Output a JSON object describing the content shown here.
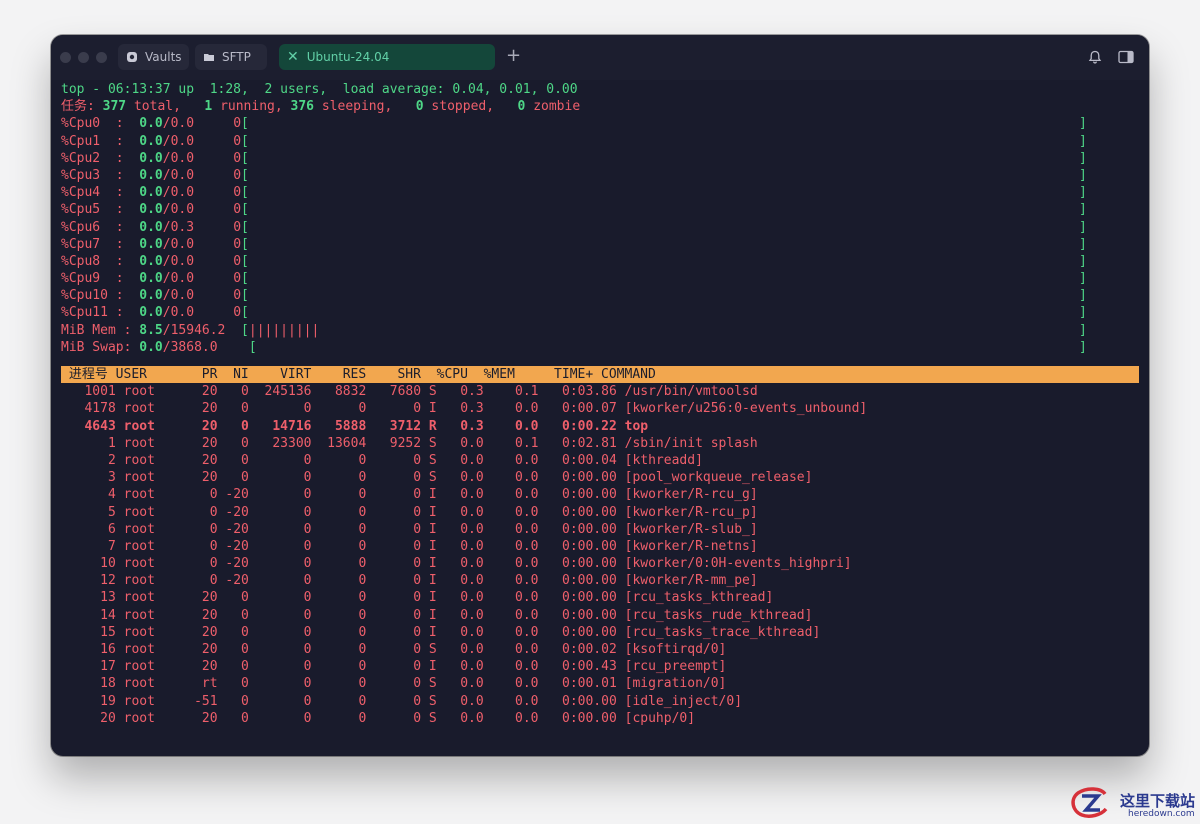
{
  "tabs": [
    {
      "label": "Vaults",
      "icon": "vaults-icon"
    },
    {
      "label": "SFTP",
      "icon": "folder-icon"
    },
    {
      "label": "Ubuntu-24.04",
      "icon": "close-icon",
      "active": true
    }
  ],
  "colors": {
    "background": "#191b2c",
    "green": "#4ed787",
    "red": "#ef5f6b",
    "header_bg": "#f2a74f",
    "active_tab": "#14473a"
  },
  "summary": {
    "top_line": "top - 06:13:37 up  1:28,  2 users,  load average: 0.04, 0.01, 0.00",
    "tasks_label": "任务:",
    "tasks_total": "377",
    "total_word": " total,",
    "running": "1",
    "running_word": " running,",
    "sleeping": "376",
    "sleeping_word": " sleeping,",
    "stopped": "0",
    "stopped_word": " stopped,",
    "zombie": "0",
    "zombie_word": " zombie"
  },
  "cpus": [
    {
      "label": "%Cpu0  :",
      "value": "0.0",
      "rest": "/0.0",
      "zero": "0"
    },
    {
      "label": "%Cpu1  :",
      "value": "0.0",
      "rest": "/0.0",
      "zero": "0"
    },
    {
      "label": "%Cpu2  :",
      "value": "0.0",
      "rest": "/0.0",
      "zero": "0"
    },
    {
      "label": "%Cpu3  :",
      "value": "0.0",
      "rest": "/0.0",
      "zero": "0"
    },
    {
      "label": "%Cpu4  :",
      "value": "0.0",
      "rest": "/0.0",
      "zero": "0"
    },
    {
      "label": "%Cpu5  :",
      "value": "0.0",
      "rest": "/0.0",
      "zero": "0"
    },
    {
      "label": "%Cpu6  :",
      "value": "0.0",
      "rest": "/0.3",
      "zero": "0"
    },
    {
      "label": "%Cpu7  :",
      "value": "0.0",
      "rest": "/0.0",
      "zero": "0"
    },
    {
      "label": "%Cpu8  :",
      "value": "0.0",
      "rest": "/0.0",
      "zero": "0"
    },
    {
      "label": "%Cpu9  :",
      "value": "0.0",
      "rest": "/0.0",
      "zero": "0"
    },
    {
      "label": "%Cpu10 :",
      "value": "0.0",
      "rest": "/0.0",
      "zero": "0"
    },
    {
      "label": "%Cpu11 :",
      "value": "0.0",
      "rest": "/0.0",
      "zero": "0"
    }
  ],
  "memory": [
    {
      "label": "MiB Mem :",
      "value": "8.5",
      "rest": "/15946.2",
      "bar": "|||||||||"
    },
    {
      "label": "MiB Swap:",
      "value": "0.0",
      "rest": "/3868.0",
      "bar": ""
    }
  ],
  "columns": [
    "进程号",
    "USER",
    "PR",
    "NI",
    "VIRT",
    "RES",
    "SHR",
    "",
    "%CPU",
    "%MEM",
    "TIME+",
    "COMMAND"
  ],
  "processes": [
    {
      "pid": "1001",
      "user": "root",
      "pr": "20",
      "ni": "0",
      "virt": "245136",
      "res": "8832",
      "shr": "7680",
      "s": "S",
      "cpu": "0.3",
      "mem": "0.1",
      "time": "0:03.86",
      "cmd": "/usr/bin/vmtoolsd"
    },
    {
      "pid": "4178",
      "user": "root",
      "pr": "20",
      "ni": "0",
      "virt": "0",
      "res": "0",
      "shr": "0",
      "s": "I",
      "cpu": "0.3",
      "mem": "0.0",
      "time": "0:00.07",
      "cmd": "[kworker/u256:0-events_unbound]"
    },
    {
      "pid": "4643",
      "user": "root",
      "pr": "20",
      "ni": "0",
      "virt": "14716",
      "res": "5888",
      "shr": "3712",
      "s": "R",
      "cpu": "0.3",
      "mem": "0.0",
      "time": "0:00.22",
      "cmd": "top",
      "bold": true
    },
    {
      "pid": "1",
      "user": "root",
      "pr": "20",
      "ni": "0",
      "virt": "23300",
      "res": "13604",
      "shr": "9252",
      "s": "S",
      "cpu": "0.0",
      "mem": "0.1",
      "time": "0:02.81",
      "cmd": "/sbin/init splash"
    },
    {
      "pid": "2",
      "user": "root",
      "pr": "20",
      "ni": "0",
      "virt": "0",
      "res": "0",
      "shr": "0",
      "s": "S",
      "cpu": "0.0",
      "mem": "0.0",
      "time": "0:00.04",
      "cmd": "[kthreadd]"
    },
    {
      "pid": "3",
      "user": "root",
      "pr": "20",
      "ni": "0",
      "virt": "0",
      "res": "0",
      "shr": "0",
      "s": "S",
      "cpu": "0.0",
      "mem": "0.0",
      "time": "0:00.00",
      "cmd": "[pool_workqueue_release]"
    },
    {
      "pid": "4",
      "user": "root",
      "pr": "0",
      "ni": "-20",
      "virt": "0",
      "res": "0",
      "shr": "0",
      "s": "I",
      "cpu": "0.0",
      "mem": "0.0",
      "time": "0:00.00",
      "cmd": "[kworker/R-rcu_g]"
    },
    {
      "pid": "5",
      "user": "root",
      "pr": "0",
      "ni": "-20",
      "virt": "0",
      "res": "0",
      "shr": "0",
      "s": "I",
      "cpu": "0.0",
      "mem": "0.0",
      "time": "0:00.00",
      "cmd": "[kworker/R-rcu_p]"
    },
    {
      "pid": "6",
      "user": "root",
      "pr": "0",
      "ni": "-20",
      "virt": "0",
      "res": "0",
      "shr": "0",
      "s": "I",
      "cpu": "0.0",
      "mem": "0.0",
      "time": "0:00.00",
      "cmd": "[kworker/R-slub_]"
    },
    {
      "pid": "7",
      "user": "root",
      "pr": "0",
      "ni": "-20",
      "virt": "0",
      "res": "0",
      "shr": "0",
      "s": "I",
      "cpu": "0.0",
      "mem": "0.0",
      "time": "0:00.00",
      "cmd": "[kworker/R-netns]"
    },
    {
      "pid": "10",
      "user": "root",
      "pr": "0",
      "ni": "-20",
      "virt": "0",
      "res": "0",
      "shr": "0",
      "s": "I",
      "cpu": "0.0",
      "mem": "0.0",
      "time": "0:00.00",
      "cmd": "[kworker/0:0H-events_highpri]"
    },
    {
      "pid": "12",
      "user": "root",
      "pr": "0",
      "ni": "-20",
      "virt": "0",
      "res": "0",
      "shr": "0",
      "s": "I",
      "cpu": "0.0",
      "mem": "0.0",
      "time": "0:00.00",
      "cmd": "[kworker/R-mm_pe]"
    },
    {
      "pid": "13",
      "user": "root",
      "pr": "20",
      "ni": "0",
      "virt": "0",
      "res": "0",
      "shr": "0",
      "s": "I",
      "cpu": "0.0",
      "mem": "0.0",
      "time": "0:00.00",
      "cmd": "[rcu_tasks_kthread]"
    },
    {
      "pid": "14",
      "user": "root",
      "pr": "20",
      "ni": "0",
      "virt": "0",
      "res": "0",
      "shr": "0",
      "s": "I",
      "cpu": "0.0",
      "mem": "0.0",
      "time": "0:00.00",
      "cmd": "[rcu_tasks_rude_kthread]"
    },
    {
      "pid": "15",
      "user": "root",
      "pr": "20",
      "ni": "0",
      "virt": "0",
      "res": "0",
      "shr": "0",
      "s": "I",
      "cpu": "0.0",
      "mem": "0.0",
      "time": "0:00.00",
      "cmd": "[rcu_tasks_trace_kthread]"
    },
    {
      "pid": "16",
      "user": "root",
      "pr": "20",
      "ni": "0",
      "virt": "0",
      "res": "0",
      "shr": "0",
      "s": "S",
      "cpu": "0.0",
      "mem": "0.0",
      "time": "0:00.02",
      "cmd": "[ksoftirqd/0]"
    },
    {
      "pid": "17",
      "user": "root",
      "pr": "20",
      "ni": "0",
      "virt": "0",
      "res": "0",
      "shr": "0",
      "s": "I",
      "cpu": "0.0",
      "mem": "0.0",
      "time": "0:00.43",
      "cmd": "[rcu_preempt]"
    },
    {
      "pid": "18",
      "user": "root",
      "pr": "rt",
      "ni": "0",
      "virt": "0",
      "res": "0",
      "shr": "0",
      "s": "S",
      "cpu": "0.0",
      "mem": "0.0",
      "time": "0:00.01",
      "cmd": "[migration/0]"
    },
    {
      "pid": "19",
      "user": "root",
      "pr": "-51",
      "ni": "0",
      "virt": "0",
      "res": "0",
      "shr": "0",
      "s": "S",
      "cpu": "0.0",
      "mem": "0.0",
      "time": "0:00.00",
      "cmd": "[idle_inject/0]"
    },
    {
      "pid": "20",
      "user": "root",
      "pr": "20",
      "ni": "0",
      "virt": "0",
      "res": "0",
      "shr": "0",
      "s": "S",
      "cpu": "0.0",
      "mem": "0.0",
      "time": "0:00.00",
      "cmd": "[cpuhp/0]"
    }
  ],
  "watermark": {
    "title": "这里下载站",
    "url": "heredown.com"
  }
}
